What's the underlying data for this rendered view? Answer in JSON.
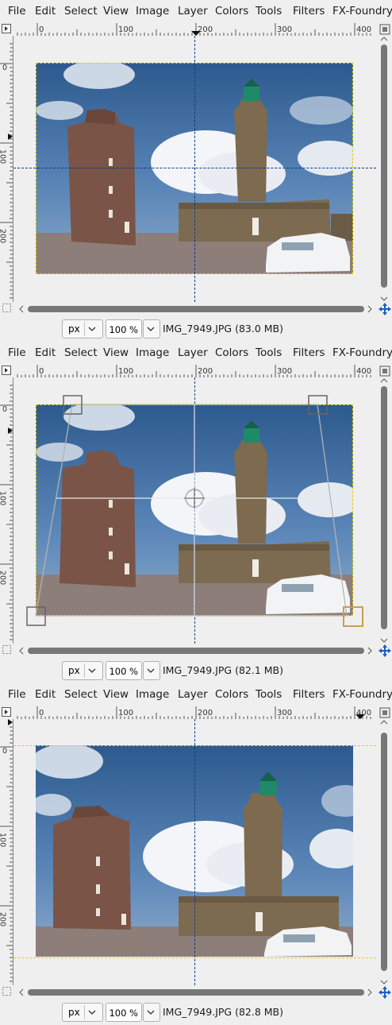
{
  "menu": [
    "File",
    "Edit",
    "Select",
    "View",
    "Image",
    "Layer",
    "Colors",
    "Tools",
    "Filters",
    "FX-Foundry"
  ],
  "ruler": {
    "h_labels": [
      "0",
      "100",
      "200",
      "300",
      "400"
    ],
    "v_labels": [
      "0",
      "100",
      "200"
    ]
  },
  "panels": [
    {
      "name": "before",
      "status": {
        "unit": "px",
        "zoom": "100 %",
        "file": "IMG_7949.JPG (83.0 MB)"
      }
    },
    {
      "name": "perspective-tool",
      "status": {
        "unit": "px",
        "zoom": "100 %",
        "file": "IMG_7949.JPG (82.1 MB)"
      }
    },
    {
      "name": "after",
      "status": {
        "unit": "px",
        "zoom": "100 %",
        "file": "IMG_7949.JPG (82.8 MB)"
      }
    }
  ],
  "icons": {
    "menu_toggle": "arrow-menu-icon",
    "navigate": "navigation-icon",
    "quick_mask": "quick-mask-icon",
    "move": "move-arrows-icon",
    "unit_dropdown": "chevron-down-icon"
  },
  "colors": {
    "sky": "#3e6fa3",
    "guide": "#0b3a8a",
    "selection": "#e4d000",
    "handle_active": "#c8a050"
  }
}
